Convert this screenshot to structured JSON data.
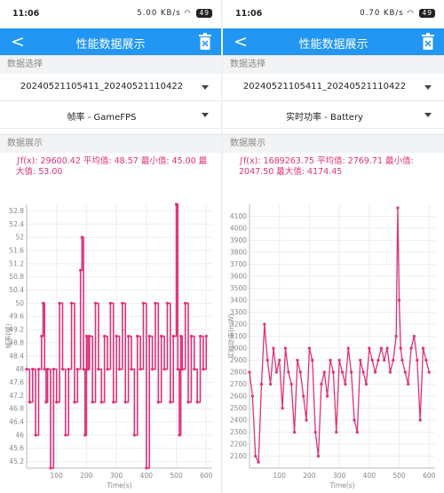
{
  "status": {
    "time": "11:06",
    "left_net": "5.00 KB/s",
    "right_net": "0.70 KB/s",
    "battery": "49"
  },
  "header": {
    "title": "性能数据展示"
  },
  "labels": {
    "data_select": "数据选择",
    "data_display": "数据展示"
  },
  "colors": {
    "accent": "#2196f3",
    "series": "#e0307a"
  },
  "screens": [
    {
      "session": "20240521105411_20240521110422",
      "metric": "帧率 - GameFPS",
      "stats": "∫f(x): 29600.42 平均值: 48.57 最小值: 45.00 最大值: 53.00",
      "chart_data": {
        "type": "line",
        "xlabel": "Time(s)",
        "ylabel": "帧率(帧)",
        "xlim": [
          0,
          620
        ],
        "ylim": [
          45.0,
          53.0
        ],
        "x_ticks": [
          100,
          200,
          300,
          400,
          500,
          600
        ],
        "y_ticks": [
          45.2,
          45.6,
          46.0,
          46.4,
          46.8,
          47.2,
          47.6,
          48.0,
          48.4,
          48.8,
          49.2,
          49.6,
          50.0,
          50.4,
          50.8,
          51.2,
          51.6,
          52.0,
          52.4,
          52.8
        ],
        "series": [
          {
            "x": [
              0,
              10,
              20,
              30,
              40,
              50,
              55,
              60,
              65,
              70,
              80,
              90,
              100,
              110,
              120,
              130,
              140,
              150,
              160,
              170,
              180,
              185,
              190,
              195,
              200,
              205,
              210,
              220,
              230,
              240,
              250,
              260,
              270,
              280,
              290,
              300,
              310,
              320,
              330,
              340,
              350,
              360,
              370,
              380,
              390,
              400,
              410,
              420,
              430,
              440,
              450,
              460,
              470,
              480,
              490,
              500,
              505,
              510,
              515,
              520,
              530,
              540,
              550,
              560,
              570,
              580,
              590,
              600
            ],
            "y": [
              48,
              47,
              48,
              46,
              48,
              49,
              50,
              48,
              47,
              48,
              45,
              48,
              47,
              50,
              48,
              46,
              48,
              50,
              47,
              48,
              51,
              52,
              48,
              46,
              49,
              48,
              49,
              47,
              50,
              48,
              47,
              49,
              48,
              50,
              47,
              49,
              48,
              50,
              47,
              49,
              48,
              46,
              49,
              48,
              50,
              45,
              49,
              48,
              50,
              47,
              49,
              48,
              50,
              47,
              49,
              53,
              48,
              46,
              49,
              48,
              50,
              47,
              49,
              48,
              47,
              49,
              48,
              49
            ]
          }
        ]
      }
    },
    {
      "session": "20240521105411_20240521110422",
      "metric": "实时功率 - Battery",
      "stats": "∫f(x): 1689263.75 平均值: 2769.71 最小值: 2047.50 最大值: 4174.45",
      "chart_data": {
        "type": "line",
        "xlabel": "Time(s)",
        "ylabel": "实时功率(mW)",
        "xlim": [
          0,
          620
        ],
        "ylim": [
          2000,
          4200
        ],
        "x_ticks": [
          100,
          200,
          300,
          400,
          500,
          600
        ],
        "y_ticks": [
          2100,
          2200,
          2300,
          2400,
          2500,
          2600,
          2700,
          2800,
          2900,
          3000,
          3100,
          3200,
          3300,
          3400,
          3500,
          3600,
          3700,
          3800,
          3900,
          4000,
          4100
        ],
        "series": [
          {
            "x": [
              0,
              10,
              20,
              30,
              40,
              50,
              60,
              70,
              80,
              90,
              100,
              110,
              120,
              130,
              140,
              150,
              160,
              170,
              180,
              190,
              200,
              210,
              220,
              230,
              240,
              250,
              260,
              270,
              280,
              290,
              300,
              310,
              320,
              330,
              340,
              350,
              360,
              370,
              380,
              390,
              400,
              410,
              420,
              430,
              440,
              450,
              460,
              470,
              480,
              490,
              495,
              500,
              505,
              510,
              520,
              530,
              540,
              550,
              560,
              570,
              580,
              590,
              600
            ],
            "y": [
              2800,
              2600,
              2100,
              2050,
              2700,
              3200,
              2900,
              2700,
              3000,
              2800,
              2900,
              2500,
              3000,
              2800,
              2700,
              2300,
              2900,
              2800,
              2600,
              2400,
              3000,
              2900,
              2300,
              2100,
              2700,
              2800,
              2600,
              2900,
              2800,
              2300,
              2900,
              2800,
              2700,
              3000,
              2800,
              2400,
              2300,
              2900,
              2800,
              2700,
              3000,
              2900,
              2800,
              2900,
              3000,
              2900,
              3000,
              2800,
              2900,
              3100,
              4170,
              3400,
              3000,
              2900,
              2800,
              2700,
              3000,
              3100,
              2900,
              2400,
              3000,
              2900,
              2800
            ]
          }
        ]
      }
    }
  ]
}
